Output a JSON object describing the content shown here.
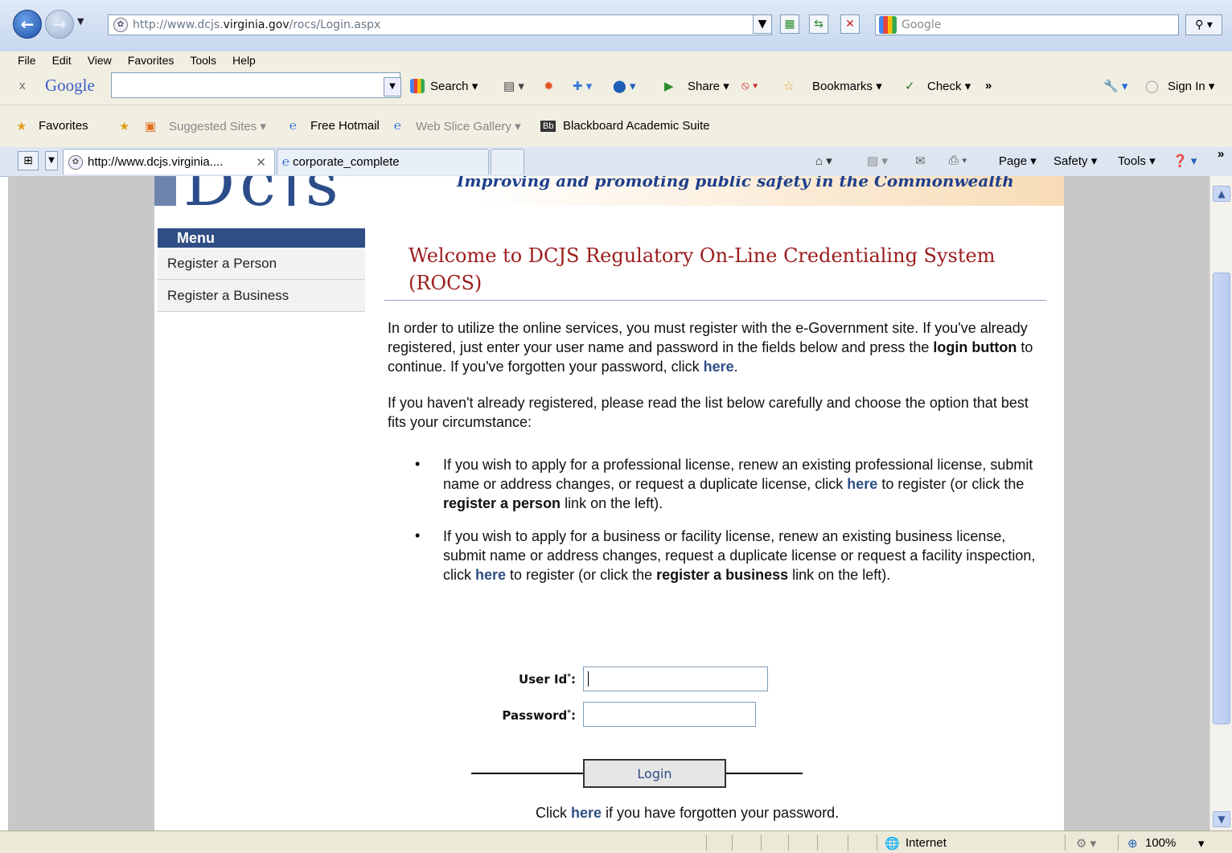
{
  "browser": {
    "url": "http://www.dcjs.virginia.gov/rocs/Login.aspx",
    "url_prefix": "http://www.dcjs.",
    "url_domain": "virginia.gov",
    "url_path": "/rocs/Login.aspx",
    "search_placeholder": "Google",
    "menu": [
      "File",
      "Edit",
      "View",
      "Favorites",
      "Tools",
      "Help"
    ],
    "google_toolbar": {
      "close": "x",
      "logo": "Google",
      "search_label": "Search",
      "share_label": "Share",
      "bookmarks_label": "Bookmarks",
      "check_label": "Check",
      "more": "»",
      "signin_label": "Sign In"
    },
    "favorites_bar": {
      "favorites_label": "Favorites",
      "suggested_sites": "Suggested Sites",
      "free_hotmail": "Free Hotmail",
      "web_slice_gallery": "Web Slice Gallery",
      "bb_badge": "Bb",
      "blackboard": "Blackboard Academic Suite"
    },
    "tabs": [
      {
        "label": "http://www.dcjs.virginia....",
        "active": true
      },
      {
        "label": "corporate_complete",
        "active": false
      }
    ],
    "command_bar": {
      "page": "Page",
      "safety": "Safety",
      "tools": "Tools",
      "more": "»"
    },
    "status": {
      "zone": "Internet",
      "zoom": "100%"
    }
  },
  "page": {
    "tagline": "Improving and promoting public safety in the Commonwealth",
    "sidebar": {
      "header": "Menu",
      "items": [
        "Register a Person",
        "Register a Business"
      ]
    },
    "welcome_title": "Welcome to DCJS Regulatory On-Line Credentialing System (ROCS)",
    "intro": {
      "p1a": "In order to utilize the online services, you must register with the e-Government site. If you've already registered, just enter your user name and password in the fields below and press the ",
      "p1b": "login button",
      "p1c": " to continue. If you've forgotten your password, click ",
      "p1d": "here",
      "p1e": ".",
      "p2": "If you haven't already registered, please read the list below carefully and choose the option that best fits your circumstance:"
    },
    "bullets": [
      {
        "a": "If you wish to apply for a professional license, renew an existing professional license, submit name or address changes, or request a duplicate license, click ",
        "link": "here",
        "b": " to register (or click the ",
        "bold": "register a person",
        "c": " link on the left)."
      },
      {
        "a": "If you wish to apply for a business or facility license, renew an existing business license, submit name or address changes, request a duplicate license or request a facility inspection, click ",
        "link": "here",
        "b": " to register (or click the ",
        "bold": "register a business",
        "c": " link on the left)."
      }
    ],
    "login_form": {
      "userid_label": "User Id",
      "password_label": "Password",
      "required_mark": "*",
      "colon": ":",
      "userid_value": "",
      "password_value": "",
      "login_button": "Login"
    },
    "forgot": {
      "a": "Click ",
      "link": "here",
      "b": " if you have forgotten your password."
    }
  }
}
